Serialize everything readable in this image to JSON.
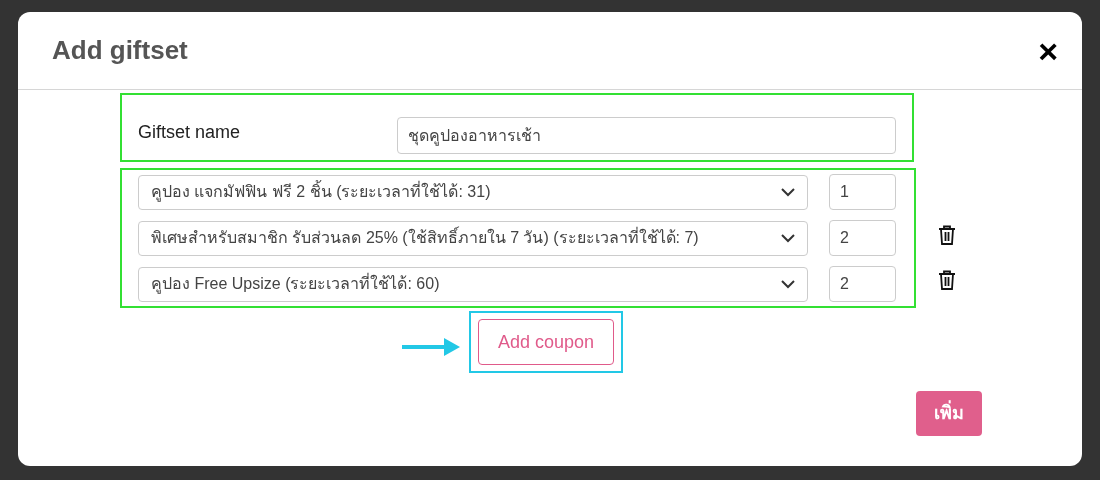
{
  "dialog": {
    "title": "Add giftset",
    "close": "×"
  },
  "giftset_name": {
    "label": "Giftset name",
    "value": "ชุดคูปองอาหารเช้า"
  },
  "coupons": [
    {
      "coupon": "คูปอง แจกมัฟฟิน ฟรี 2 ชิ้น (ระยะเวลาที่ใช้ได้: 31)",
      "quantity": "1",
      "deletable": false
    },
    {
      "coupon": "พิเศษสำหรับสมาชิก รับส่วนลด 25% (ใช้สิทธิ์ภายใน 7 วัน) (ระยะเวลาที่ใช้ได้: 7)",
      "quantity": "2",
      "deletable": true
    },
    {
      "coupon": "คูปอง Free Upsize (ระยะเวลาที่ใช้ได้: 60)",
      "quantity": "2",
      "deletable": true
    }
  ],
  "add_coupon_button": "Add coupon",
  "submit_button": "เพิ่ม"
}
